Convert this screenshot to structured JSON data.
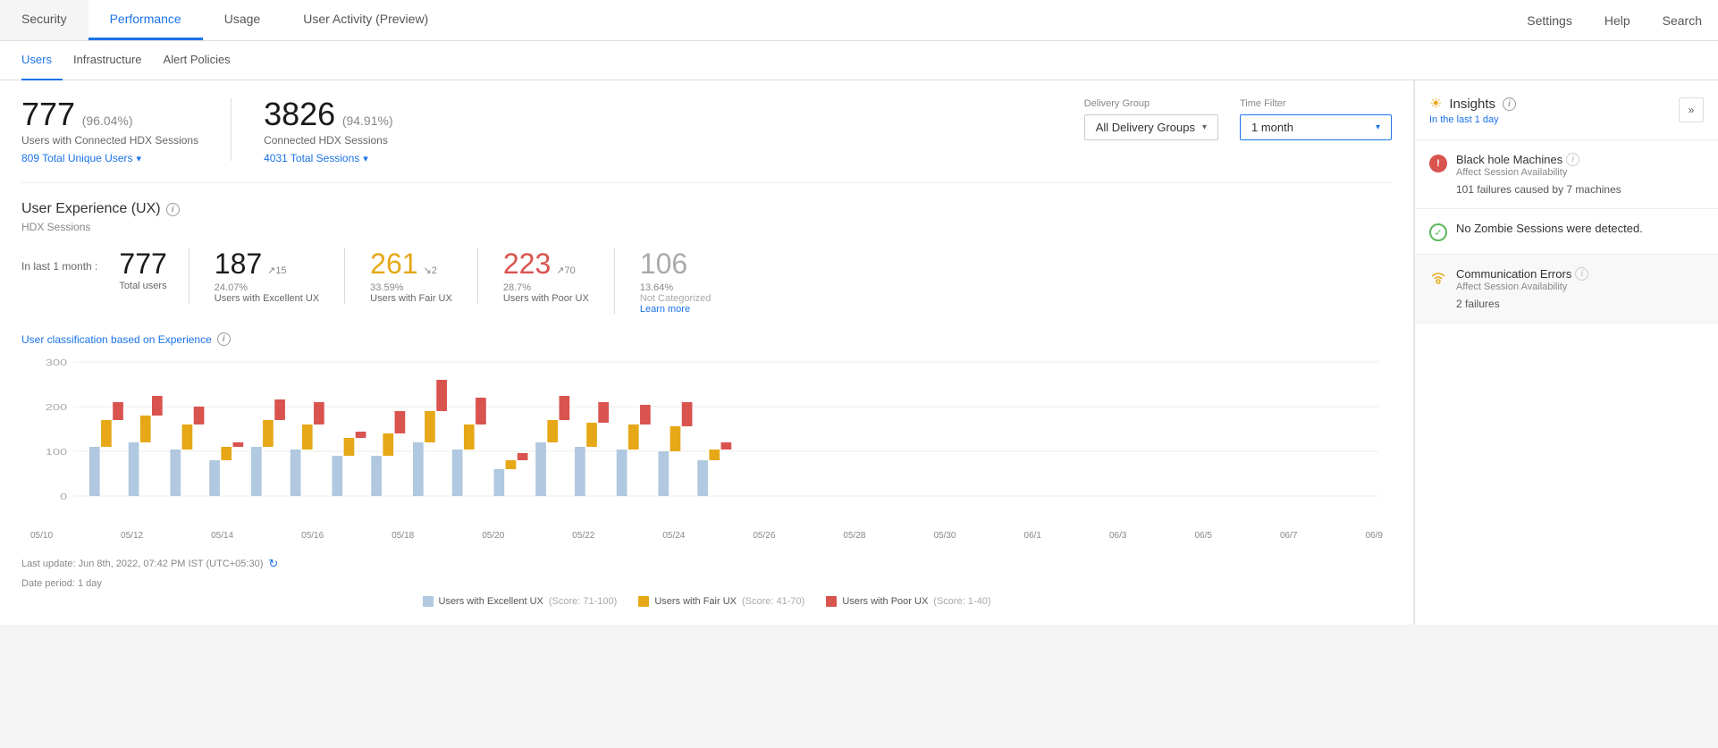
{
  "topNav": {
    "tabs": [
      {
        "id": "security",
        "label": "Security",
        "active": false
      },
      {
        "id": "performance",
        "label": "Performance",
        "active": true
      },
      {
        "id": "usage",
        "label": "Usage",
        "active": false
      },
      {
        "id": "user-activity",
        "label": "User Activity (Preview)",
        "active": false
      }
    ],
    "rightItems": [
      {
        "id": "settings",
        "label": "Settings"
      },
      {
        "id": "help",
        "label": "Help"
      },
      {
        "id": "search",
        "label": "Search"
      }
    ]
  },
  "subNav": {
    "items": [
      {
        "id": "users",
        "label": "Users",
        "active": true
      },
      {
        "id": "infrastructure",
        "label": "Infrastructure",
        "active": false
      },
      {
        "id": "alert-policies",
        "label": "Alert Policies",
        "active": false
      }
    ]
  },
  "stats": {
    "connectedUsers": {
      "number": "777",
      "pct": "(96.04%)",
      "label": "Users with Connected HDX Sessions",
      "linkText": "809 Total Unique Users"
    },
    "connectedSessions": {
      "number": "3826",
      "pct": "(94.91%)",
      "label": "Connected HDX Sessions",
      "linkText": "4031 Total Sessions"
    }
  },
  "filters": {
    "deliveryGroup": {
      "label": "Delivery Group",
      "value": "All Delivery Groups"
    },
    "timeFilter": {
      "label": "Time Filter",
      "value": "1 month"
    }
  },
  "ux": {
    "title": "User Experience (UX)",
    "subtitle": "HDX Sessions",
    "periodLabel": "In last 1 month :",
    "stats": [
      {
        "id": "total",
        "value": "777",
        "sublabel": "Total users",
        "color": "excellent",
        "trend": ""
      },
      {
        "id": "excellent",
        "value": "187",
        "trend": "↗15",
        "pct": "24.07%",
        "sublabel": "Users with Excellent UX",
        "color": "excellent"
      },
      {
        "id": "fair",
        "value": "261",
        "trend": "↘2",
        "pct": "33.59%",
        "sublabel": "Users with Fair UX",
        "color": "fair"
      },
      {
        "id": "poor",
        "value": "223",
        "trend": "↗70",
        "pct": "28.7%",
        "sublabel": "Users with Poor UX",
        "color": "poor"
      },
      {
        "id": "uncategorized",
        "value": "106",
        "pct": "13.64%",
        "sublabel": "Not Categorized",
        "color": "gray",
        "learnMore": "Learn more"
      }
    ]
  },
  "chart": {
    "title": "User classification based on Experience",
    "yLabels": [
      "300",
      "200",
      "100"
    ],
    "xLabels": [
      "05/10",
      "05/12",
      "05/14",
      "05/16",
      "05/18",
      "05/20",
      "05/22",
      "05/24",
      "05/26",
      "05/28",
      "05/30",
      "06/1",
      "06/3",
      "06/5",
      "06/7",
      "06/9"
    ],
    "legend": [
      {
        "id": "excellent",
        "label": "Users with Excellent UX",
        "sublabel": "(Score: 71-100)",
        "color": "#b0c8e0"
      },
      {
        "id": "fair",
        "label": "Users with Fair UX",
        "sublabel": "(Score: 41-70)",
        "color": "#e6a817"
      },
      {
        "id": "poor",
        "label": "Users with Poor UX",
        "sublabel": "(Score: 1-40)",
        "color": "#d9534f"
      }
    ],
    "footer": "Last update: Jun 8th, 2022, 07:42 PM IST (UTC+05:30)",
    "footerSub": "Date period: 1 day"
  },
  "insights": {
    "title": "Insights",
    "subtitle": "In the last 1 day",
    "items": [
      {
        "id": "black-hole",
        "type": "alert",
        "name": "Black hole Machines",
        "affect": "Affect Session Availability",
        "detail": "101 failures caused by 7 machines",
        "highlighted": false
      },
      {
        "id": "zombie-sessions",
        "type": "ok",
        "name": "No Zombie Sessions were detected.",
        "affect": "",
        "detail": "",
        "highlighted": false
      },
      {
        "id": "comm-errors",
        "type": "warn",
        "name": "Communication Errors",
        "affect": "Affect Session Availability",
        "detail": "2 failures",
        "highlighted": true
      }
    ]
  }
}
